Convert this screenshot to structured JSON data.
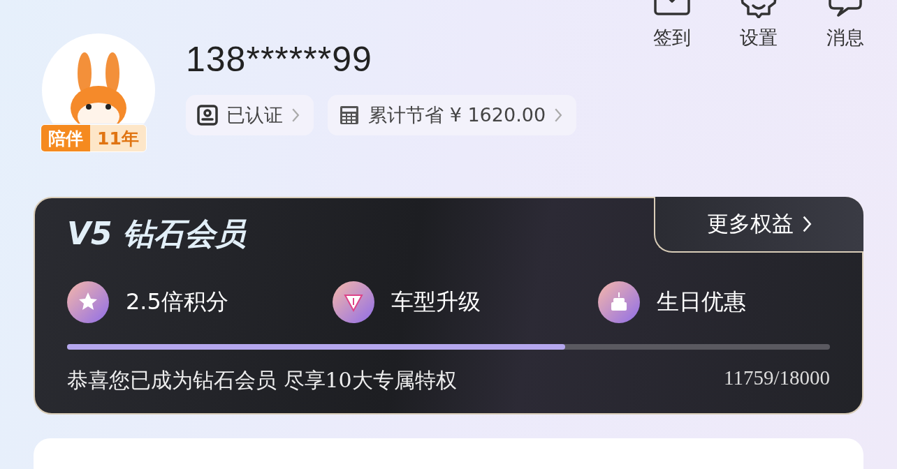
{
  "header_actions": [
    {
      "label": "签到",
      "kind": "checkin"
    },
    {
      "label": "设置",
      "kind": "settings"
    },
    {
      "label": "消息",
      "kind": "message"
    }
  ],
  "profile": {
    "phone": "138******99",
    "badge": {
      "left": "陪伴",
      "right": "11年"
    },
    "chips": [
      {
        "kind": "id",
        "label": "已认证"
      },
      {
        "kind": "calculator",
        "label": "累计节省 ¥ 1620.00"
      }
    ]
  },
  "membership": {
    "title": "V5 钻石会员",
    "more": "更多权益",
    "benefits": [
      {
        "kind": "star",
        "label": "2.5倍积分"
      },
      {
        "kind": "diamond",
        "label": "车型升级"
      },
      {
        "kind": "cake",
        "label": "生日优惠"
      }
    ],
    "progress": {
      "level": 0.653
    },
    "message": "恭喜您已成为钻石会员 尽享10大专属特权",
    "points": "11759/18000"
  }
}
